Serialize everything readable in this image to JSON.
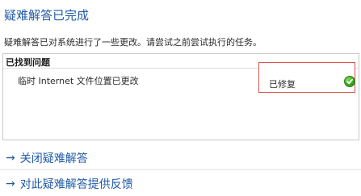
{
  "title": "疑难解答已完成",
  "description": "疑难解答已对系统进行了一些更改。请尝试之前尝试执行的任务。",
  "panel": {
    "header": "已找到问题",
    "issue": "临时 Internet 文件位置已更改",
    "status": "已修复",
    "status_icon": "green-check-icon"
  },
  "actions": {
    "close": {
      "arrow": "→",
      "label": "关闭疑难解答"
    },
    "feedback": {
      "arrow": "→",
      "label": "对此疑难解答提供反馈"
    }
  },
  "colors": {
    "link": "#1f5aa6",
    "highlight_border": "#d9534f",
    "success": "#3aa81f"
  }
}
